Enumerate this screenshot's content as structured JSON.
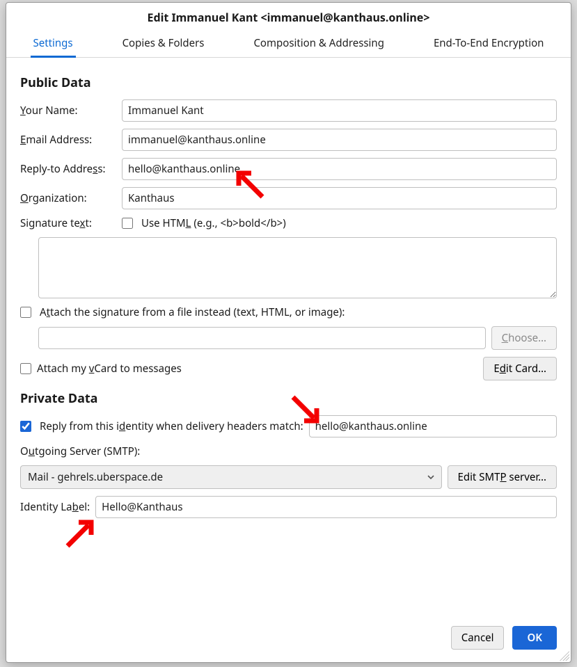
{
  "dialog": {
    "title": "Edit Immanuel Kant <immanuel@kanthaus.online>"
  },
  "tabs": {
    "settings": "Settings",
    "copies": "Copies & Folders",
    "composition": "Composition & Addressing",
    "e2e": "End-To-End Encryption"
  },
  "public": {
    "heading": "Public Data",
    "name_label_pre": "Y",
    "name_label_post": "our Name:",
    "name_value": "Immanuel Kant",
    "email_label_pre": "E",
    "email_label_post": "mail Address:",
    "email_value": "immanuel@kanthaus.online",
    "reply_label_pre": "Reply-to Addre",
    "reply_label_mid": "s",
    "reply_label_post": "s:",
    "reply_value": "hello@kanthaus.online",
    "org_label_pre": "O",
    "org_label_post": "rganization:",
    "org_value": "Kanthaus",
    "sig_label_pre": "Signature te",
    "sig_label_mid": "x",
    "sig_label_post": "t:",
    "use_html_pre": "Use HTM",
    "use_html_mid": "L",
    "use_html_post": " (e.g., <b>bold</b>)",
    "signature_value": "",
    "attach_file_pre": "A",
    "attach_file_mid": "t",
    "attach_file_post": "tach the signature from a file instead (text, HTML, or image):",
    "file_path": "",
    "choose_pre": "C",
    "choose_post": "hoose…",
    "attach_vcard_pre": "Attach my ",
    "attach_vcard_mid": "v",
    "attach_vcard_post": "Card to messages",
    "edit_card_pre": "E",
    "edit_card_mid": "d",
    "edit_card_post": "it Card…"
  },
  "private": {
    "heading": "Private Data",
    "reply_identity_pre": "Reply from this i",
    "reply_identity_mid": "d",
    "reply_identity_post": "entity when delivery headers match:",
    "reply_identity_value": "hello@kanthaus.online",
    "outgoing_pre": "O",
    "outgoing_mid": "u",
    "outgoing_post": "tgoing Server (SMTP):",
    "smtp_selected": "Mail - gehrels.uberspace.de",
    "edit_smtp_pre": "Edit SMT",
    "edit_smtp_mid": "P",
    "edit_smtp_post": " server…",
    "identity_label_pre": "Identity La",
    "identity_label_mid": "b",
    "identity_label_post": "el:",
    "identity_value": "Hello@Kanthaus"
  },
  "footer": {
    "cancel": "Cancel",
    "ok": "OK"
  }
}
